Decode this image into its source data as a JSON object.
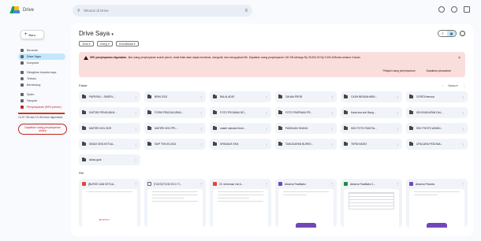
{
  "app": {
    "name": "Drive"
  },
  "search": {
    "placeholder": "Telusuri di Drive"
  },
  "sidebar": {
    "new_label": "Baru",
    "items": [
      {
        "label": "Beranda",
        "active": false
      },
      {
        "label": "Drive Saya",
        "active": true
      },
      {
        "label": "Komputer",
        "active": false
      },
      {
        "label": "Dibagikan kepada saya",
        "active": false
      },
      {
        "label": "Terbaru",
        "active": false
      },
      {
        "label": "Berbintang",
        "active": false
      },
      {
        "label": "Spam",
        "active": false
      },
      {
        "label": "Sampah",
        "active": false
      },
      {
        "label": "Penyimpanan (99% penuh)",
        "active": false
      }
    ],
    "storage_text": "14,97 GB dari 15 GB telah digunakan",
    "storage_fraction": 0.99,
    "storage_button": "Dapatkan ruang penyimpanan ekstra"
  },
  "main": {
    "title": "Drive Saya",
    "filters": [
      "Jenis",
      "Orang",
      "Dimodifikasi"
    ],
    "banner": {
      "text_bold": "99% penyimpanan digunakan.",
      "text": "Jika ruang penyimpanan sudah penuh, Anda tidak akan dapat membuat, mengedit, dan mengupload file. Dapatkan ruang penyimpanan 100 GB seharga Rp 26.900,00 Rp 9.400,00/bulan selama 3 bulan.",
      "action_primary": "Pelajari ruang penyimpanan",
      "action_secondary": "Dapatkan penawaran",
      "color": "#f9dedc"
    },
    "folders_label": "Folder",
    "sort_label": "Nama",
    "folders": [
      "PAPERKU - SINEFIL...",
      "BRIN 2023",
      "BALAI ADAT",
      "ZAHAA PROB",
      "CASH BENDAHARA...",
      "CERITA bersua",
      "DAFTAR PENGUBLIK...",
      "FORM PENGUKURAN...",
      "FOTO PEGAWAI BO...",
      "FOTO PIMPINAN PR...",
      "Kada kua koh Bang...",
      "KELENGKAPAN DAL...",
      "MATERI KKN ODR",
      "MATERI KKN PPL...",
      "materi sekolah Kesh...",
      "PANDUAN SHAHU",
      "SKK FOTO PANITIA...",
      "SKK PHOTO ADMIN...",
      "SIMUS SKN KETUA...",
      "SMP THN IN 2024",
      "SPANDUK KKN",
      "TANGGAPAN BUPATI...",
      "TERM INDEX",
      "UPACARA PEDOMA...",
      "siklas goal"
    ],
    "files_label": "File",
    "files": [
      {
        "name": "[BUPATI DAN KETUA...",
        "type": "pdf",
        "color": "#ea4335"
      },
      {
        "name": "[TUKS] FOOD ECO TI...",
        "type": "doc",
        "color": "#ffffff"
      },
      {
        "name": "20. Informasi Cal A...",
        "type": "pdf",
        "color": "#ea4335"
      },
      {
        "name": "Absensi Fasilitator",
        "type": "form",
        "color": "#7248b9"
      },
      {
        "name": "Absensi Fasilitator 1...",
        "type": "sheet",
        "color": "#1e8e3e"
      },
      {
        "name": "Absensi Peserta",
        "type": "form",
        "color": "#7248b9"
      }
    ],
    "file_thumb_text": "BUPATI"
  },
  "colors": {
    "accent": "#c2e7ff",
    "warning": "#c5221f",
    "form_purple": "#7248b9"
  }
}
